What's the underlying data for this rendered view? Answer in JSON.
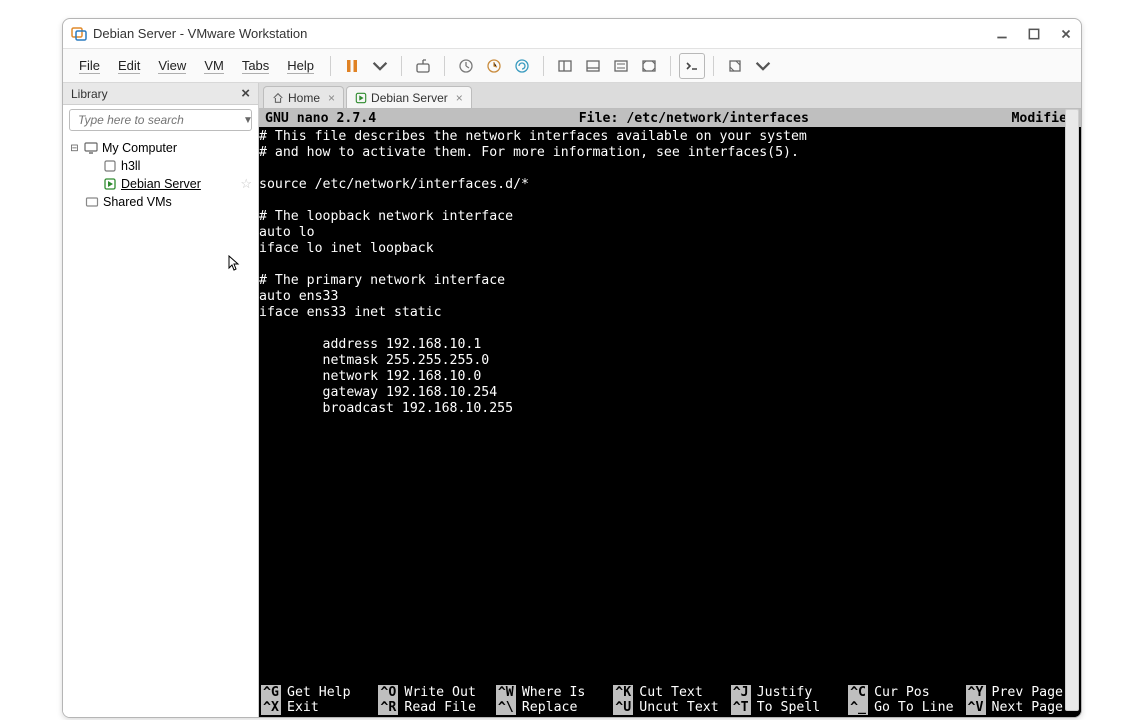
{
  "title": "Debian Server - VMware Workstation",
  "menu": {
    "file": "File",
    "edit": "Edit",
    "view": "View",
    "vm": "VM",
    "tabs": "Tabs",
    "help": "Help"
  },
  "library": {
    "header": "Library",
    "search_placeholder": "Type here to search",
    "nodes": {
      "root": "My Computer",
      "h3ll": "h3ll",
      "debian": "Debian Server",
      "shared": "Shared VMs"
    }
  },
  "tabs": {
    "home": "Home",
    "active": "Debian Server"
  },
  "nano": {
    "app": "GNU nano 2.7.4",
    "file_label": "File: /etc/network/interfaces",
    "modified": "Modified",
    "body": "# This file describes the network interfaces available on your system\n# and how to activate them. For more information, see interfaces(5).\n\nsource /etc/network/interfaces.d/*\n\n# The loopback network interface\nauto lo\niface lo inet loopback\n\n# The primary network interface\nauto ens33\niface ens33 inet static\n\n        address 192.168.10.1\n        netmask 255.255.255.0\n        network 192.168.10.0\n        gateway 192.168.10.254\n        broadcast 192.168.10.255",
    "help": {
      "g": "Get Help",
      "x": "Exit",
      "o": "Write Out",
      "r": "Read File",
      "w": "Where Is",
      "bs": "Replace",
      "k": "Cut Text",
      "u": "Uncut Text",
      "j": "Justify",
      "t": "To Spell",
      "c": "Cur Pos",
      "sl": "Go To Line",
      "y": "Prev Page",
      "v": "Next Page"
    }
  }
}
